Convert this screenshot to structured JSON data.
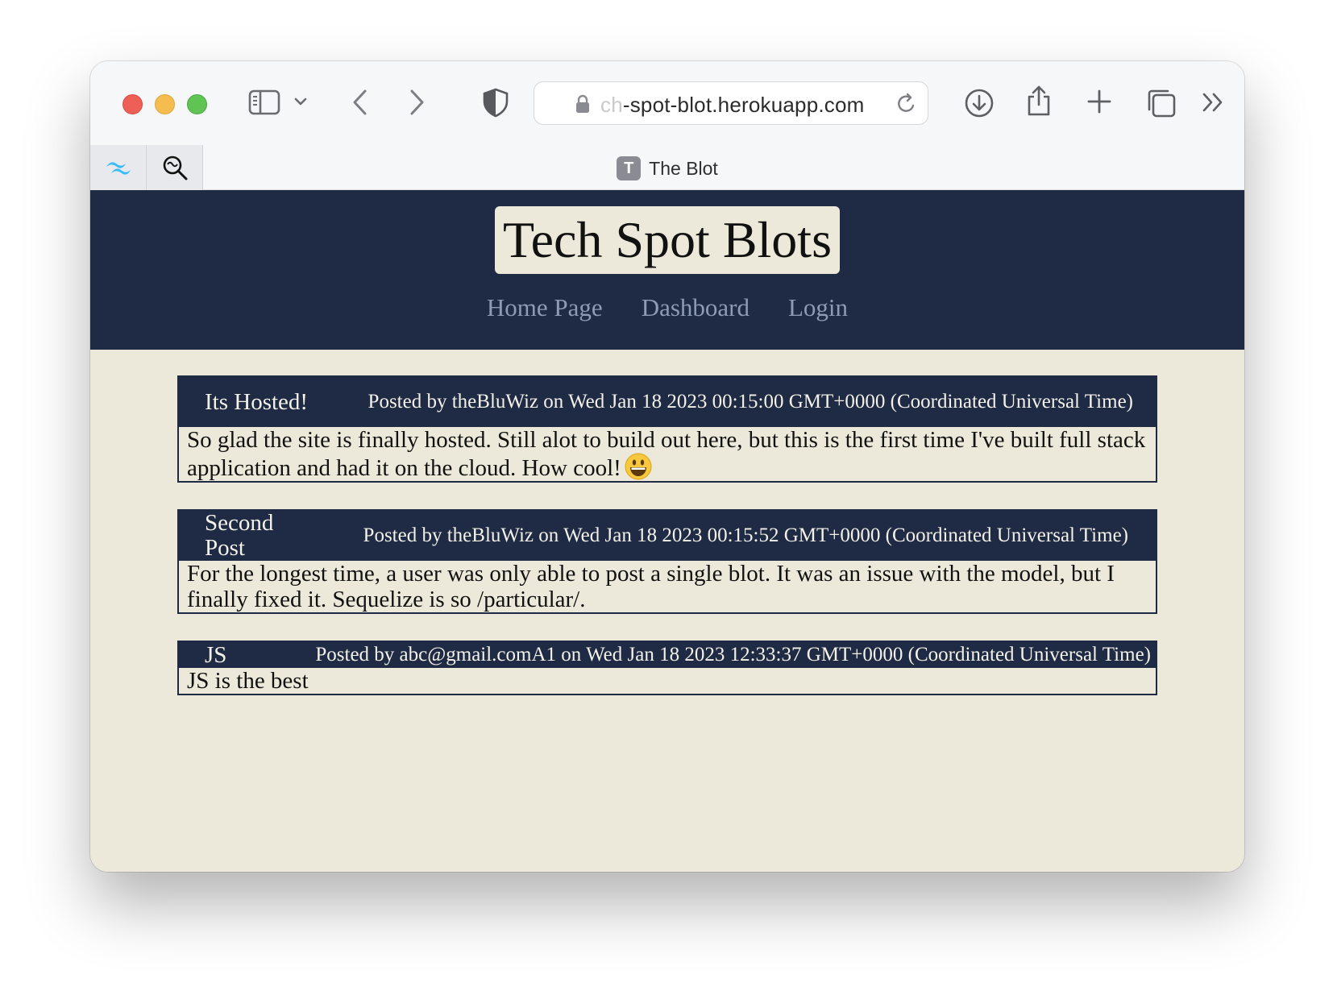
{
  "browser": {
    "address_prefix": "ch",
    "address_url": "-spot-blot.herokuapp.com",
    "tab_title": "The Blot",
    "tab_favicon_letter": "T"
  },
  "site": {
    "title": "Tech Spot Blots",
    "nav": {
      "home": "Home Page",
      "dashboard": "Dashboard",
      "login": "Login"
    }
  },
  "posts": [
    {
      "title": "Its Hosted!",
      "meta": "Posted by theBluWiz on Wed Jan 18 2023 00:15:00 GMT+0000 (Coordinated Universal Time)",
      "body": "So glad the site is finally hosted. Still alot to build out here, but this is the first time I've built full stack application and had it on the cloud. How cool!"
    },
    {
      "title": "Second Post",
      "meta": "Posted by theBluWiz on Wed Jan 18 2023 00:15:52 GMT+0000 (Coordinated Universal Time)",
      "body": "For the longest time, a user was only able to post a single blot. It was an issue with the model, but I finally fixed it. Sequelize is so /particular/."
    },
    {
      "title": "JS",
      "meta": "Posted by abc@gmail.comA1 on Wed Jan 18 2023 12:33:37 GMT+0000 (Coordinated Universal Time)",
      "body": "JS is the best"
    }
  ],
  "colors": {
    "header_bg": "#1f2b44",
    "page_bg": "#ede9da",
    "nav_link": "#8d9bb5"
  }
}
